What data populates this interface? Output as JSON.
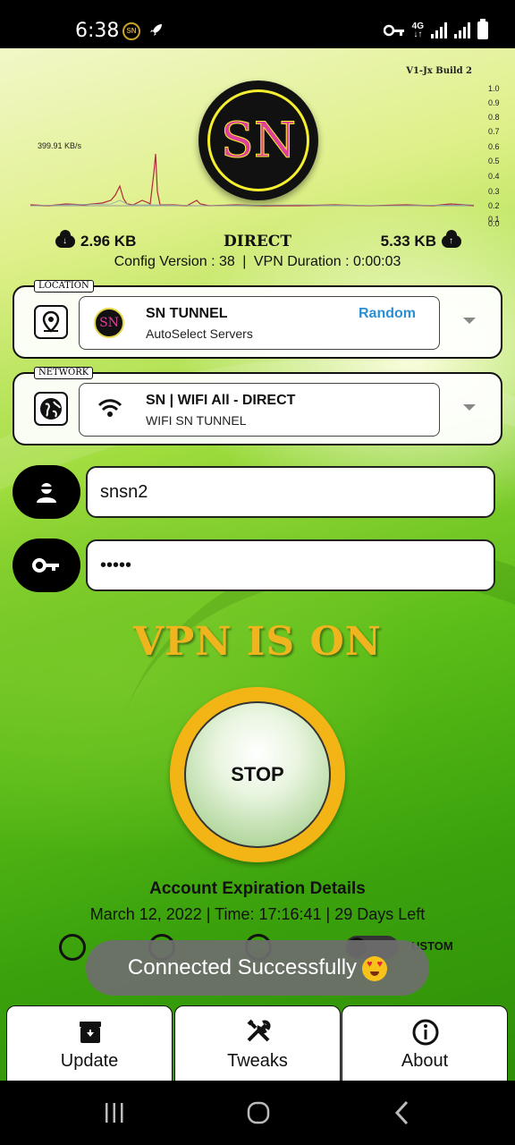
{
  "status_bar": {
    "time": "6:38",
    "network": "4G",
    "icons": [
      "sn-app-icon",
      "rocket-icon",
      "vpn-key-icon",
      "signal-icon",
      "signal-icon",
      "battery-icon"
    ]
  },
  "graph": {
    "build_label": "V1-Jx Build 2",
    "speed_label": "399.91 KB/s",
    "y_ticks": [
      "1.0",
      "0.9",
      "0.8",
      "0.7",
      "0.6",
      "0.5",
      "0.4",
      "0.3",
      "0.2",
      "0.1",
      "0.0"
    ]
  },
  "logo": {
    "text": "SN"
  },
  "stats": {
    "download": "2.96 KB",
    "mode": "DIRECT",
    "upload": "5.33 KB",
    "config_version": "Config Version : 38",
    "vpn_duration": "VPN Duration : 0:00:03"
  },
  "location": {
    "tag": "LOCATION",
    "server_name": "SN TUNNEL",
    "server_sub": "AutoSelect Servers",
    "random_label": "Random",
    "badge_text": "SN"
  },
  "network": {
    "tag": "NETWORK",
    "name": "SN | WIFI All - DIRECT",
    "sub": "WIFI SN TUNNEL"
  },
  "credentials": {
    "username": "snsn2",
    "password": "•••••"
  },
  "vpn_status": "VPN IS ON",
  "stop_label": "STOP",
  "account": {
    "title": "Account Expiration Details",
    "details": "March 12, 2022 | Time: 17:16:41 | 29 Days Left"
  },
  "radio_labels": {
    "custom": "USTOM"
  },
  "toast": {
    "text": "Connected Successfully"
  },
  "tabs": [
    {
      "label": "Update",
      "icon": "archive-icon"
    },
    {
      "label": "Tweaks",
      "icon": "tools-icon"
    },
    {
      "label": "About",
      "icon": "info-icon"
    }
  ],
  "colors": {
    "accent_yellow": "#f2b515",
    "random_blue": "#2b8fd4",
    "logo_pink": "#e0409a"
  }
}
